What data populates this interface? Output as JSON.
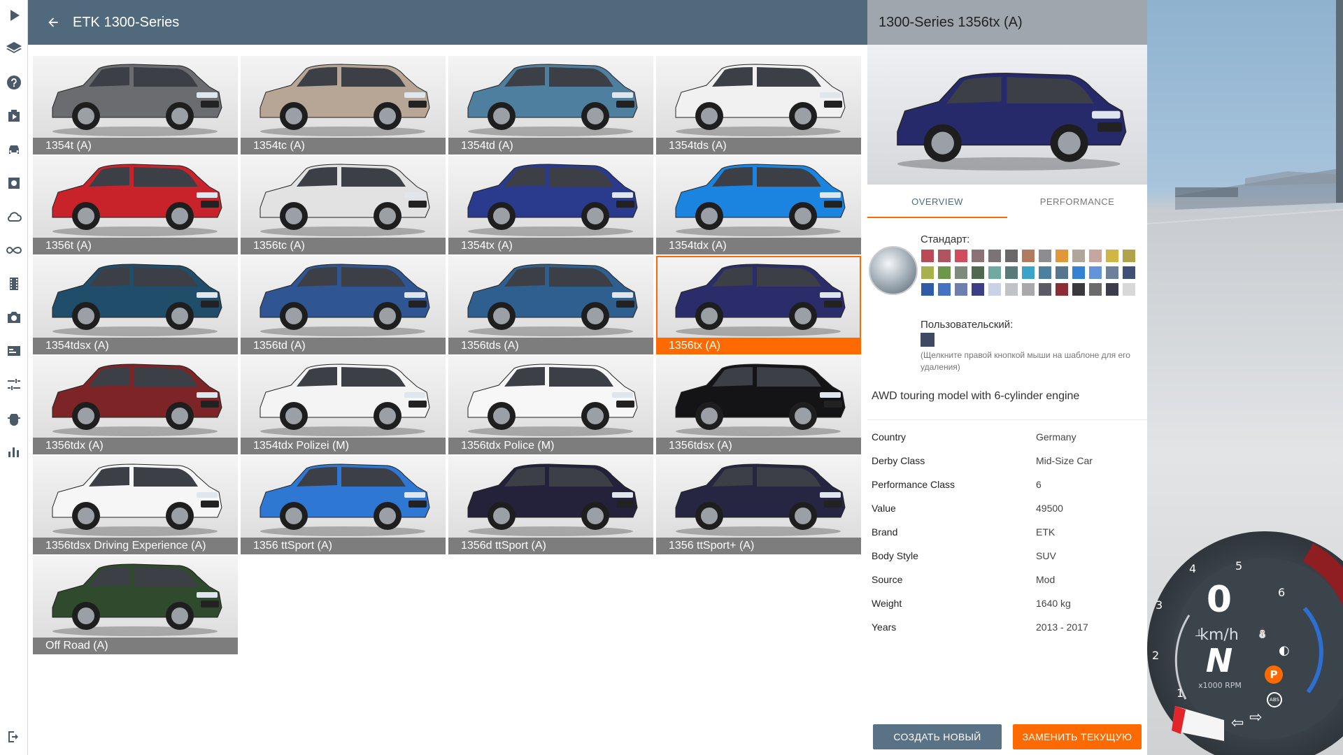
{
  "list": {
    "title": "ETK 1300-Series",
    "vehicles": [
      {
        "label": "1354t (A)",
        "color": "#6a6c70",
        "selected": false
      },
      {
        "label": "1354tc (A)",
        "color": "#b7a695",
        "selected": false
      },
      {
        "label": "1354td (A)",
        "color": "#4f7f9f",
        "selected": false
      },
      {
        "label": "1354tds (A)",
        "color": "#f1f1f1",
        "selected": false
      },
      {
        "label": "1356t (A)",
        "color": "#c8232a",
        "selected": false
      },
      {
        "label": "1356tc (A)",
        "color": "#e2e2e2",
        "selected": false
      },
      {
        "label": "1354tx (A)",
        "color": "#2a3a8c",
        "selected": false
      },
      {
        "label": "1354tdx (A)",
        "color": "#1b84e0",
        "selected": false
      },
      {
        "label": "1354tdsx (A)",
        "color": "#1f4d6a",
        "selected": false
      },
      {
        "label": "1356td (A)",
        "color": "#2f5592",
        "selected": false
      },
      {
        "label": "1356tds (A)",
        "color": "#2f5f8e",
        "selected": false
      },
      {
        "label": "1356tx (A)",
        "color": "#2a2d6a",
        "selected": true
      },
      {
        "label": "1356tdx (A)",
        "color": "#7d2427",
        "selected": false
      },
      {
        "label": "1354tdx Polizei (M)",
        "color": "#f4f4f4",
        "selected": false
      },
      {
        "label": "1356tdx Police (M)",
        "color": "#f7f7f7",
        "selected": false
      },
      {
        "label": "1356tdsx (A)",
        "color": "#141416",
        "selected": false
      },
      {
        "label": "1356tdsx Driving Experience (A)",
        "color": "#f6f6f6",
        "selected": false
      },
      {
        "label": "1356 ttSport (A)",
        "color": "#2e78d4",
        "selected": false
      },
      {
        "label": "1356d ttSport (A)",
        "color": "#24223a",
        "selected": false
      },
      {
        "label": "1356 ttSport+ (A)",
        "color": "#262642",
        "selected": false
      },
      {
        "label": "Off Road (A)",
        "color": "#2f4a2c",
        "selected": false
      }
    ]
  },
  "detail": {
    "title": "1300-Series 1356tx (A)",
    "preview_color": "#262a6a",
    "tabs": {
      "overview": "OVERVIEW",
      "performance": "PERFORMANCE"
    },
    "paints": {
      "standard_label": "Стандарт:",
      "custom_label": "Пользовательский:",
      "hint": "(Щелкните правой кнопкой мыши на шаблоне для его удаления)",
      "swatches": [
        "#b84b55",
        "#b05460",
        "#d24d5c",
        "#8c7274",
        "#7a7476",
        "#6a6869",
        "#b07b5f",
        "#8d8d8f",
        "#e29838",
        "#b1a69c",
        "#c8a6a0",
        "#d1b645",
        "#b1a34a",
        "#a7b24c",
        "#6d9749",
        "#7e8a7c",
        "#51694f",
        "#6fa9a1",
        "#5a7a7a",
        "#3aa4c8",
        "#4c7fa0",
        "#56758f",
        "#3283d3",
        "#6394d9",
        "#6d809a",
        "#3f5178",
        "#2f5ca8",
        "#4672c4",
        "#6c7fae",
        "#3d3f86",
        "#c9d2e6",
        "#c0c3c7",
        "#a9a9ab",
        "#5b5a66",
        "#8c2d36",
        "#3a3a3c",
        "#6d6a6c",
        "#3b3d4f",
        "#d8d8d8"
      ],
      "custom_color": "#3e4a63"
    },
    "description": "AWD touring model with 6-cylinder engine",
    "spec": [
      {
        "key": "Country",
        "value": "Germany"
      },
      {
        "key": "Derby Class",
        "value": "Mid-Size Car"
      },
      {
        "key": "Performance Class",
        "value": "6"
      },
      {
        "key": "Value",
        "value": "49500"
      },
      {
        "key": "Brand",
        "value": "ETK"
      },
      {
        "key": "Body Style",
        "value": "SUV"
      },
      {
        "key": "Source",
        "value": "Mod"
      },
      {
        "key": "Weight",
        "value": "1640 kg"
      },
      {
        "key": "Years",
        "value": "2013 - 2017"
      }
    ],
    "buttons": {
      "new": "СОЗДАТЬ НОВЫЙ",
      "replace": "ЗАМЕНИТЬ ТЕКУЩУЮ"
    }
  },
  "sidebar": {
    "icons": [
      "play-icon",
      "layers-icon",
      "help-icon",
      "scenario-icon",
      "car-icon",
      "settings-gear-icon",
      "cloud-icon",
      "infinity-icon",
      "film-icon",
      "camera-icon",
      "ui-apps-icon",
      "sliders-icon",
      "bug-icon",
      "stats-icon",
      "exit-icon"
    ]
  },
  "hud": {
    "speed": "0",
    "speed_unit": "km/h",
    "gear": "N",
    "rpm_unit": "x1000 RPM",
    "rpm_ticks": [
      "1",
      "2",
      "3",
      "4",
      "5",
      "6"
    ],
    "parking": "P",
    "abs": "ABS"
  }
}
